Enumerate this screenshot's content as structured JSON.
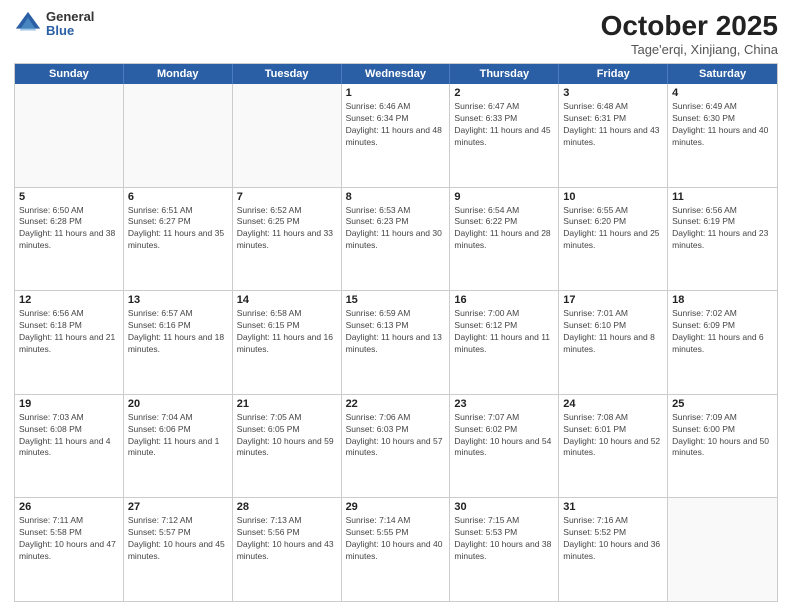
{
  "header": {
    "logo_general": "General",
    "logo_blue": "Blue",
    "month_title": "October 2025",
    "subtitle": "Tage'erqi, Xinjiang, China"
  },
  "day_headers": [
    "Sunday",
    "Monday",
    "Tuesday",
    "Wednesday",
    "Thursday",
    "Friday",
    "Saturday"
  ],
  "weeks": [
    [
      {
        "date": "",
        "info": ""
      },
      {
        "date": "",
        "info": ""
      },
      {
        "date": "",
        "info": ""
      },
      {
        "date": "1",
        "info": "Sunrise: 6:46 AM\nSunset: 6:34 PM\nDaylight: 11 hours and 48 minutes."
      },
      {
        "date": "2",
        "info": "Sunrise: 6:47 AM\nSunset: 6:33 PM\nDaylight: 11 hours and 45 minutes."
      },
      {
        "date": "3",
        "info": "Sunrise: 6:48 AM\nSunset: 6:31 PM\nDaylight: 11 hours and 43 minutes."
      },
      {
        "date": "4",
        "info": "Sunrise: 6:49 AM\nSunset: 6:30 PM\nDaylight: 11 hours and 40 minutes."
      }
    ],
    [
      {
        "date": "5",
        "info": "Sunrise: 6:50 AM\nSunset: 6:28 PM\nDaylight: 11 hours and 38 minutes."
      },
      {
        "date": "6",
        "info": "Sunrise: 6:51 AM\nSunset: 6:27 PM\nDaylight: 11 hours and 35 minutes."
      },
      {
        "date": "7",
        "info": "Sunrise: 6:52 AM\nSunset: 6:25 PM\nDaylight: 11 hours and 33 minutes."
      },
      {
        "date": "8",
        "info": "Sunrise: 6:53 AM\nSunset: 6:23 PM\nDaylight: 11 hours and 30 minutes."
      },
      {
        "date": "9",
        "info": "Sunrise: 6:54 AM\nSunset: 6:22 PM\nDaylight: 11 hours and 28 minutes."
      },
      {
        "date": "10",
        "info": "Sunrise: 6:55 AM\nSunset: 6:20 PM\nDaylight: 11 hours and 25 minutes."
      },
      {
        "date": "11",
        "info": "Sunrise: 6:56 AM\nSunset: 6:19 PM\nDaylight: 11 hours and 23 minutes."
      }
    ],
    [
      {
        "date": "12",
        "info": "Sunrise: 6:56 AM\nSunset: 6:18 PM\nDaylight: 11 hours and 21 minutes."
      },
      {
        "date": "13",
        "info": "Sunrise: 6:57 AM\nSunset: 6:16 PM\nDaylight: 11 hours and 18 minutes."
      },
      {
        "date": "14",
        "info": "Sunrise: 6:58 AM\nSunset: 6:15 PM\nDaylight: 11 hours and 16 minutes."
      },
      {
        "date": "15",
        "info": "Sunrise: 6:59 AM\nSunset: 6:13 PM\nDaylight: 11 hours and 13 minutes."
      },
      {
        "date": "16",
        "info": "Sunrise: 7:00 AM\nSunset: 6:12 PM\nDaylight: 11 hours and 11 minutes."
      },
      {
        "date": "17",
        "info": "Sunrise: 7:01 AM\nSunset: 6:10 PM\nDaylight: 11 hours and 8 minutes."
      },
      {
        "date": "18",
        "info": "Sunrise: 7:02 AM\nSunset: 6:09 PM\nDaylight: 11 hours and 6 minutes."
      }
    ],
    [
      {
        "date": "19",
        "info": "Sunrise: 7:03 AM\nSunset: 6:08 PM\nDaylight: 11 hours and 4 minutes."
      },
      {
        "date": "20",
        "info": "Sunrise: 7:04 AM\nSunset: 6:06 PM\nDaylight: 11 hours and 1 minute."
      },
      {
        "date": "21",
        "info": "Sunrise: 7:05 AM\nSunset: 6:05 PM\nDaylight: 10 hours and 59 minutes."
      },
      {
        "date": "22",
        "info": "Sunrise: 7:06 AM\nSunset: 6:03 PM\nDaylight: 10 hours and 57 minutes."
      },
      {
        "date": "23",
        "info": "Sunrise: 7:07 AM\nSunset: 6:02 PM\nDaylight: 10 hours and 54 minutes."
      },
      {
        "date": "24",
        "info": "Sunrise: 7:08 AM\nSunset: 6:01 PM\nDaylight: 10 hours and 52 minutes."
      },
      {
        "date": "25",
        "info": "Sunrise: 7:09 AM\nSunset: 6:00 PM\nDaylight: 10 hours and 50 minutes."
      }
    ],
    [
      {
        "date": "26",
        "info": "Sunrise: 7:11 AM\nSunset: 5:58 PM\nDaylight: 10 hours and 47 minutes."
      },
      {
        "date": "27",
        "info": "Sunrise: 7:12 AM\nSunset: 5:57 PM\nDaylight: 10 hours and 45 minutes."
      },
      {
        "date": "28",
        "info": "Sunrise: 7:13 AM\nSunset: 5:56 PM\nDaylight: 10 hours and 43 minutes."
      },
      {
        "date": "29",
        "info": "Sunrise: 7:14 AM\nSunset: 5:55 PM\nDaylight: 10 hours and 40 minutes."
      },
      {
        "date": "30",
        "info": "Sunrise: 7:15 AM\nSunset: 5:53 PM\nDaylight: 10 hours and 38 minutes."
      },
      {
        "date": "31",
        "info": "Sunrise: 7:16 AM\nSunset: 5:52 PM\nDaylight: 10 hours and 36 minutes."
      },
      {
        "date": "",
        "info": ""
      }
    ]
  ]
}
